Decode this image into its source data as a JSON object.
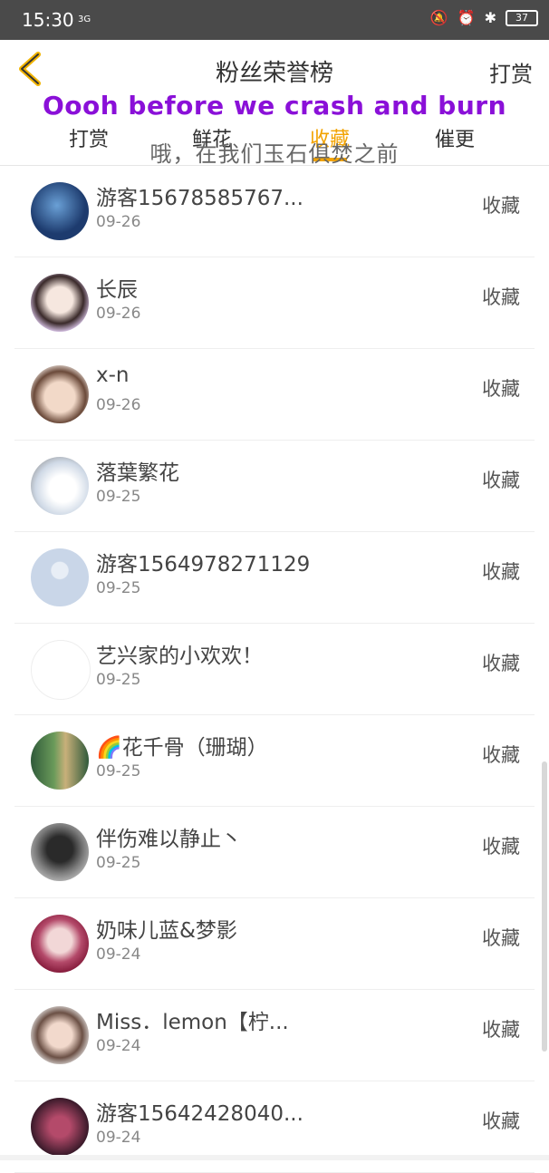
{
  "status": {
    "time": "15:30",
    "net": "3G",
    "battery": "37"
  },
  "header": {
    "title": "粉丝荣誉榜",
    "right": "打赏"
  },
  "lyrics": {
    "en": "Oooh before we crash and burn",
    "cn": "哦，在我们玉石俱焚之前"
  },
  "tabs": [
    {
      "label": "打赏"
    },
    {
      "label": "鲜花"
    },
    {
      "label": "收藏"
    },
    {
      "label": "催更"
    }
  ],
  "items": [
    {
      "name": "游客15678585767...",
      "date": "09-26",
      "action": "收藏",
      "avatar_colors": [
        "#1d3b6e",
        "#6aa0d6"
      ]
    },
    {
      "name": "长辰",
      "date": "09-26",
      "action": "收藏",
      "avatar_colors": [
        "#d9c4e8",
        "#3a2a2a"
      ]
    },
    {
      "name": "x-n",
      "date": "09-26",
      "action": "收藏",
      "avatar_colors": [
        "#f2d9c8",
        "#6b4a3a"
      ]
    },
    {
      "name": "落葉繁花",
      "date": "09-25",
      "action": "收藏",
      "avatar_colors": [
        "#cfd9e6",
        "#8a8a8a"
      ]
    },
    {
      "name": "游客15649782711​29",
      "date": "09-25",
      "action": "收藏",
      "avatar_colors": [
        "#c9d6e8",
        "#e8eef6"
      ]
    },
    {
      "name": "艺兴家的小欢欢！",
      "date": "09-25",
      "action": "收藏",
      "avatar_colors": [
        "#ffffff",
        "#333333"
      ]
    },
    {
      "name": "🌈花千骨（珊瑚）",
      "date": "09-25",
      "action": "收藏",
      "avatar_colors": [
        "#2f5a3a",
        "#c8b07a"
      ]
    },
    {
      "name": "伴伤难以静止丶",
      "date": "09-25",
      "action": "收藏",
      "avatar_colors": [
        "#2a2a2a",
        "#bdbdbd"
      ]
    },
    {
      "name": "奶味儿蓝&梦影",
      "date": "09-24",
      "action": "收藏",
      "avatar_colors": [
        "#7a1030",
        "#f2d7d7"
      ]
    },
    {
      "name": "Miss．lemon【柠...",
      "date": "09-24",
      "action": "收藏",
      "avatar_colors": [
        "#f2f2f2",
        "#6b5045"
      ]
    },
    {
      "name": "游客15642428040...",
      "date": "09-24",
      "action": "收藏",
      "avatar_colors": [
        "#3a1a2a",
        "#b44a6a"
      ]
    }
  ]
}
